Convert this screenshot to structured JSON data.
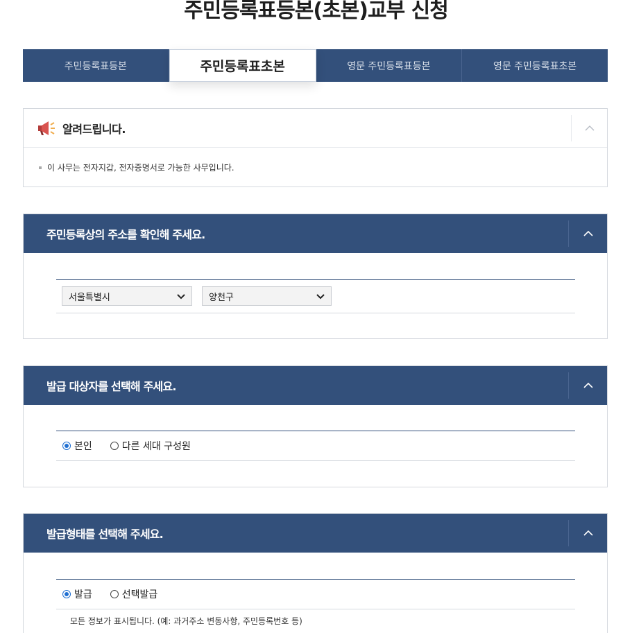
{
  "page": {
    "title": "주민등록표등본(초본)교부 신청"
  },
  "tabs": [
    {
      "label": "주민등록표등본",
      "active": false
    },
    {
      "label": "주민등록표초본",
      "active": true
    },
    {
      "label": "영문 주민등록표등본",
      "active": false
    },
    {
      "label": "영문 주민등록표초본",
      "active": false
    }
  ],
  "notice": {
    "title": "알려드립니다.",
    "text": "이 사무는 전자지갑, 전자증명서로 가능한 사무입니다.",
    "icon": "megaphone-icon"
  },
  "address_section": {
    "title": "주민등록상의 주소를 확인해 주세요.",
    "city": {
      "value": "서울특별시"
    },
    "district": {
      "value": "양천구"
    }
  },
  "target_section": {
    "title": "발급 대상자를 선택해 주세요.",
    "options": [
      {
        "label": "본인",
        "checked": true
      },
      {
        "label": "다른 세대 구성원",
        "checked": false
      }
    ]
  },
  "format_section": {
    "title": "발급형태를 선택해 주세요.",
    "options": [
      {
        "label": "발급",
        "checked": true
      },
      {
        "label": "선택발급",
        "checked": false
      }
    ],
    "description": "모든 정보가 표시됩니다. (예: 과거주소 변동사항, 주민등록번호 등)"
  },
  "colors": {
    "primary": "#33507b",
    "radio_accent": "#1f6fd1"
  }
}
